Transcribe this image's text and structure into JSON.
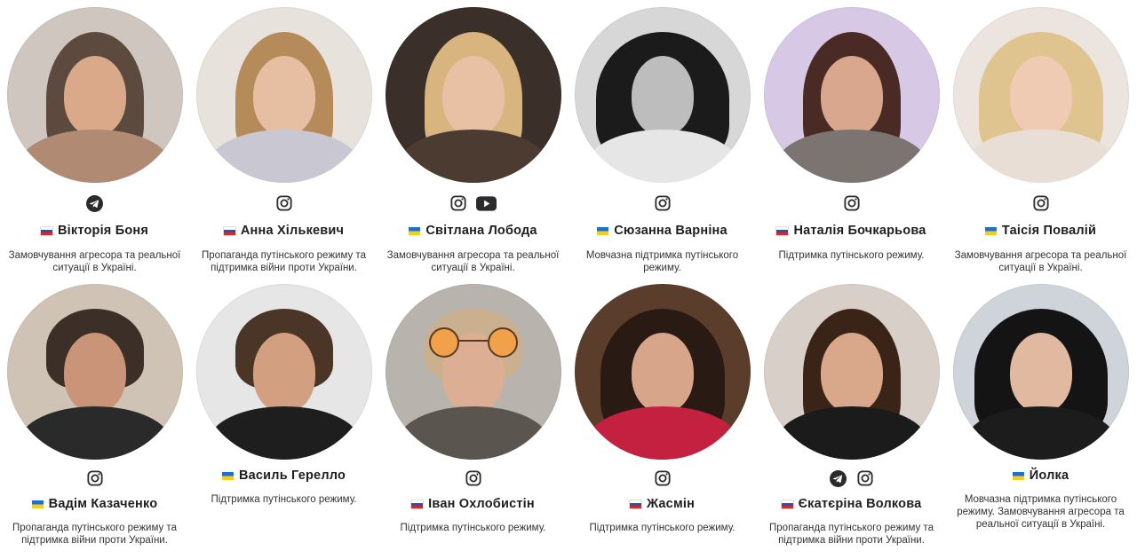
{
  "colors": {
    "ua_blue": "#1f6fd1",
    "ua_yellow": "#f2cf1f",
    "ru_white": "#ffffff",
    "ru_blue": "#2a4fb5",
    "ru_red": "#d12a2a",
    "icon": "#2b2b2b"
  },
  "people": [
    {
      "name": "Вікторія Боня",
      "flag": "ru",
      "socials": [
        "telegram-icon"
      ],
      "description": "Замовчування агресора та реальної ситуації в Україні."
    },
    {
      "name": "Анна Хількевич",
      "flag": "ru",
      "socials": [
        "instagram-icon"
      ],
      "description": "Пропаганда путінського режиму та підтримка війни проти України."
    },
    {
      "name": "Світлана Лобода",
      "flag": "ua",
      "socials": [
        "instagram-icon",
        "youtube-icon"
      ],
      "description": "Замовчування агресора та реальної ситуації в Україні."
    },
    {
      "name": "Сюзанна Варніна",
      "flag": "ua",
      "socials": [
        "instagram-icon"
      ],
      "description": "Мовчазна підтримка путінського режиму."
    },
    {
      "name": "Наталія Бочкарьова",
      "flag": "ru",
      "socials": [
        "instagram-icon"
      ],
      "description": "Підтримка путінського режиму."
    },
    {
      "name": "Таісія Повалій",
      "flag": "ua",
      "socials": [
        "instagram-icon"
      ],
      "description": "Замовчування агресора та реальної ситуації в Україні."
    },
    {
      "name": "Вадім Казаченко",
      "flag": "ua",
      "socials": [
        "instagram-icon"
      ],
      "description": "Пропаганда путінського режиму та підтримка війни проти України."
    },
    {
      "name": "Василь Герелло",
      "flag": "ua",
      "socials": [],
      "description": "Підтримка путінського режиму."
    },
    {
      "name": "Іван Охлобистін",
      "flag": "ru",
      "socials": [
        "instagram-icon"
      ],
      "description": "Підтримка путінського режиму."
    },
    {
      "name": "Жасмін",
      "flag": "ru",
      "socials": [
        "instagram-icon"
      ],
      "description": "Підтримка путінського режиму."
    },
    {
      "name": "Єкатєріна Волкова",
      "flag": "ru",
      "socials": [
        "telegram-icon",
        "instagram-icon"
      ],
      "description": "Пропаганда путінського режиму та підтримка війни проти України."
    },
    {
      "name": "Йолка",
      "flag": "ua",
      "socials": [],
      "description": "Мовчазна підтримка путінського режиму. Замовчування агресора та реальної ситуації в Україні."
    }
  ]
}
